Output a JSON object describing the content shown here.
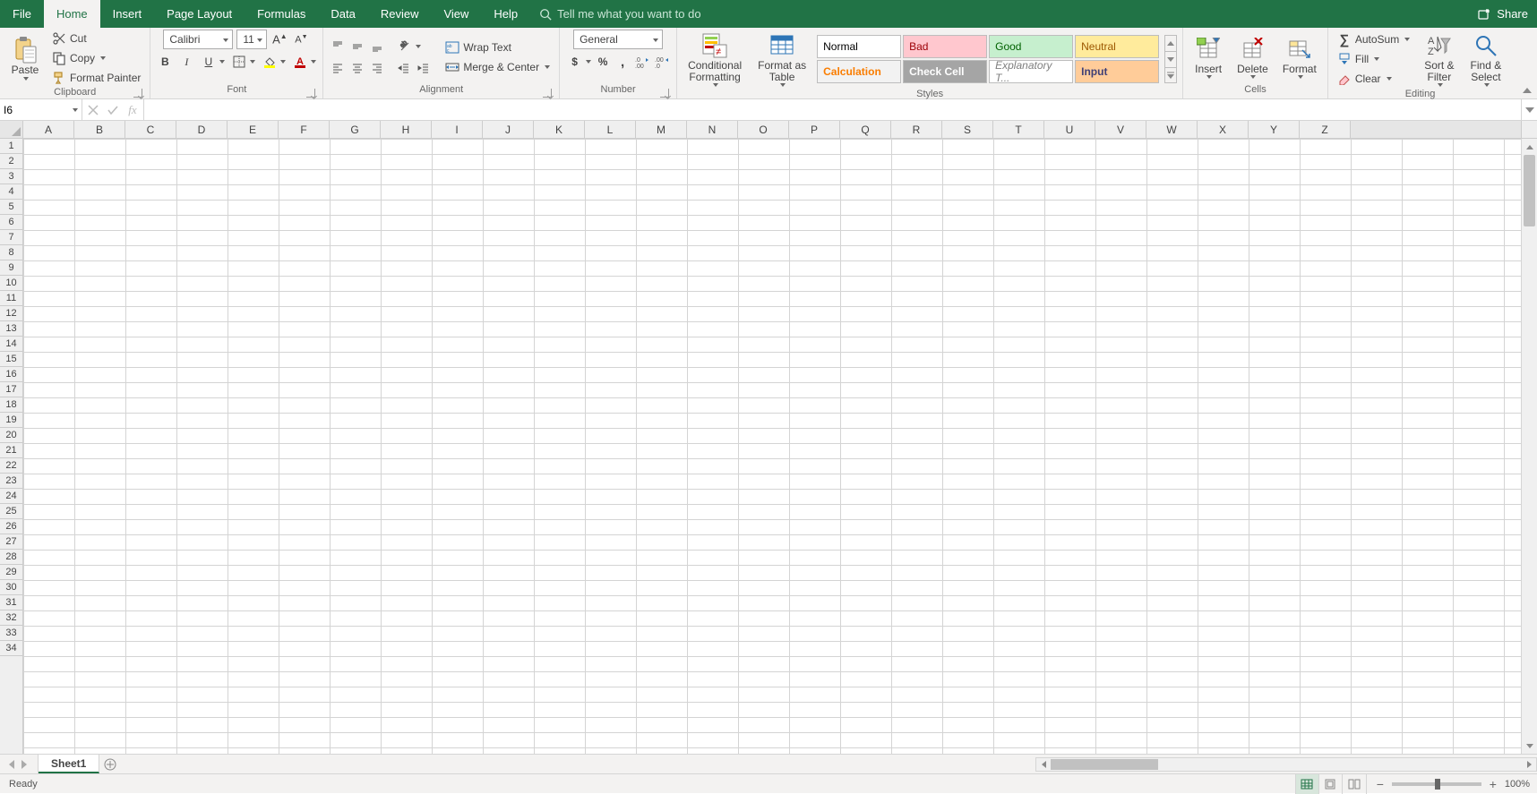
{
  "menubar": {
    "tabs": [
      "File",
      "Home",
      "Insert",
      "Page Layout",
      "Formulas",
      "Data",
      "Review",
      "View",
      "Help"
    ],
    "active": "Home",
    "tellme_placeholder": "Tell me what you want to do",
    "share": "Share"
  },
  "ribbon": {
    "clipboard": {
      "label": "Clipboard",
      "paste": "Paste",
      "cut": "Cut",
      "copy": "Copy",
      "format_painter": "Format Painter"
    },
    "font": {
      "label": "Font",
      "name": "Calibri",
      "size": "11"
    },
    "alignment": {
      "label": "Alignment",
      "wrap_text": "Wrap Text",
      "merge_center": "Merge & Center"
    },
    "number": {
      "label": "Number",
      "format": "General"
    },
    "styles": {
      "label": "Styles",
      "conditional_formatting": "Conditional\nFormatting",
      "format_as_table": "Format as\nTable",
      "gallery": [
        {
          "name": "Normal",
          "cls": "normal"
        },
        {
          "name": "Bad",
          "cls": "bad"
        },
        {
          "name": "Good",
          "cls": "good"
        },
        {
          "name": "Neutral",
          "cls": "neutral"
        },
        {
          "name": "Calculation",
          "cls": "calc"
        },
        {
          "name": "Check Cell",
          "cls": "check"
        },
        {
          "name": "Explanatory T...",
          "cls": "explan"
        },
        {
          "name": "Input",
          "cls": "input"
        }
      ]
    },
    "cells": {
      "label": "Cells",
      "insert": "Insert",
      "delete": "Delete",
      "format": "Format"
    },
    "editing": {
      "label": "Editing",
      "autosum": "AutoSum",
      "fill": "Fill",
      "clear": "Clear",
      "sort_filter": "Sort &\nFilter",
      "find_select": "Find &\nSelect"
    }
  },
  "formulabar": {
    "namebox": "I6",
    "formula": ""
  },
  "grid": {
    "columns": [
      "A",
      "B",
      "C",
      "D",
      "E",
      "F",
      "G",
      "H",
      "I",
      "J",
      "K",
      "L",
      "M",
      "N",
      "O",
      "P",
      "Q",
      "R",
      "S",
      "T",
      "U",
      "V",
      "W",
      "X",
      "Y",
      "Z"
    ],
    "rows": 34
  },
  "sheets": {
    "active": "Sheet1"
  },
  "statusbar": {
    "ready": "Ready",
    "zoom": "100%"
  }
}
